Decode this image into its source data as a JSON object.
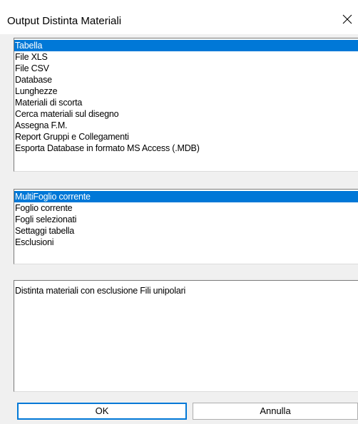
{
  "window": {
    "title": "Output Distinta Materiali",
    "close_icon": "close-icon"
  },
  "output_types": {
    "items": [
      "Tabella",
      "File XLS",
      "File CSV",
      "Database",
      "Lunghezze",
      "Materiali di scorta",
      "Cerca materiali sul disegno",
      "Assegna F.M.",
      "Report Gruppi e Collegamenti",
      "Esporta Database in formato MS Access (.MDB)"
    ],
    "selected": "Tabella"
  },
  "scope": {
    "items": [
      "MultiFoglio corrente",
      "Foglio corrente",
      "Fogli selezionati",
      "Settaggi tabella",
      "Esclusioni"
    ],
    "selected": "MultiFoglio corrente"
  },
  "description": {
    "text": "Distinta materiali con esclusione Fili unipolari"
  },
  "buttons": {
    "ok_label": "OK",
    "cancel_label": "Annulla"
  },
  "colors": {
    "selection": "#0078d7",
    "dialog_background": "#f0f0f0"
  }
}
